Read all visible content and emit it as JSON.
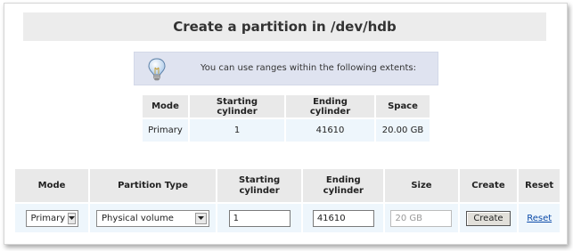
{
  "page": {
    "title": "Create a partition in /dev/hdb"
  },
  "info": {
    "icon": "lightbulb-icon",
    "text": "You can use ranges within the following extents:"
  },
  "extents": {
    "headers": [
      "Mode",
      "Starting cylinder",
      "Ending cylinder",
      "Space"
    ],
    "row": [
      "Primary",
      "1",
      "41610",
      "20.00 GB"
    ]
  },
  "form": {
    "headers": {
      "mode": "Mode",
      "partition_type": "Partition Type",
      "starting_cylinder": "Starting cylinder",
      "ending_cylinder": "Ending cylinder",
      "size": "Size",
      "create": "Create",
      "reset": "Reset"
    },
    "mode_value": "Primary",
    "partition_type_value": "Physical volume",
    "starting_cylinder_value": "1",
    "ending_cylinder_value": "41610",
    "size_placeholder": "20 GB",
    "create_button_label": "Create",
    "reset_link_label": "Reset"
  },
  "colors": {
    "link": "#0b4aa8",
    "header_bg": "#e9e9e9",
    "cell_bg": "#eef6fc",
    "info_bg": "#dfe3f0"
  }
}
